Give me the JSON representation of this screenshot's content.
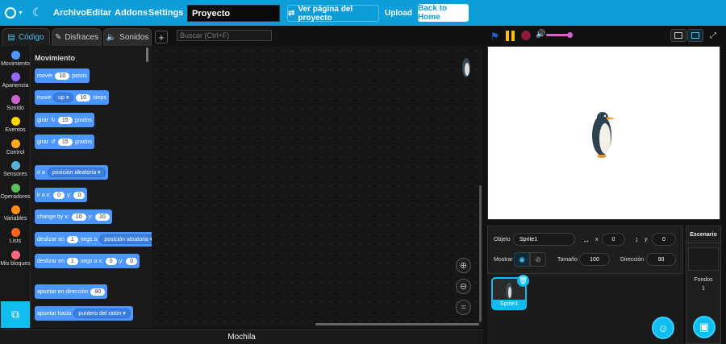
{
  "menu": {
    "items": [
      "Archivo",
      "Editar",
      "Addons",
      "Settings"
    ],
    "project_title": "Proyecto",
    "see_project": "Ver página del proyecto",
    "upload": "Upload",
    "back_home": "Back to Home"
  },
  "tabs": [
    {
      "label": "Código",
      "icon": "code-icon"
    },
    {
      "label": "Disfraces",
      "icon": "brush-icon"
    },
    {
      "label": "Sonidos",
      "icon": "speaker-icon"
    }
  ],
  "search_placeholder": "Buscar (Ctrl+F)",
  "categories": [
    {
      "label": "Movimiento",
      "color": "#4c97ff"
    },
    {
      "label": "Apariencia",
      "color": "#9966ff"
    },
    {
      "label": "Sonido",
      "color": "#cf63cf"
    },
    {
      "label": "Eventos",
      "color": "#ffd500"
    },
    {
      "label": "Control",
      "color": "#ffab19"
    },
    {
      "label": "Sensores",
      "color": "#5cb1d6"
    },
    {
      "label": "Operadores",
      "color": "#59c059"
    },
    {
      "label": "Variables",
      "color": "#ff8c1a"
    },
    {
      "label": "Lists",
      "color": "#ff661a"
    },
    {
      "label": "Mis bloques",
      "color": "#ff6680"
    }
  ],
  "palette": {
    "title": "Movimiento",
    "blocks": {
      "move_steps": {
        "a": "mover",
        "v": "10",
        "b": "pasos"
      },
      "move_dir": {
        "a": "move",
        "dd": "up",
        "v": "10",
        "b": "steps"
      },
      "turn_right": {
        "a": "girar",
        "v": "15",
        "b": "grados"
      },
      "turn_left": {
        "a": "girar",
        "v": "15",
        "b": "grados"
      },
      "goto": {
        "a": "ir a",
        "dd": "posición aleatoria"
      },
      "goto_xy": {
        "a": "ir a x:",
        "x": "0",
        "ylab": "y:",
        "y": "0"
      },
      "change_by": {
        "a": "change by x:",
        "x": "10",
        "ylab": "y:",
        "y": "10"
      },
      "glide_to": {
        "a": "deslizar en",
        "v": "1",
        "b": "segs a",
        "dd": "posición aleatoria"
      },
      "glide_xy": {
        "a": "deslizar en",
        "v": "1",
        "b": "segs a x:",
        "x": "0",
        "ylab": "y:",
        "y": "0"
      },
      "point_dir": {
        "a": "apuntar en dirección",
        "v": "90"
      },
      "point_towards": {
        "a": "apuntar hacia",
        "dd": "puntero del ratón"
      }
    }
  },
  "bottom_bar": "Mochila",
  "sprite_info": {
    "objeto_label": "Objeto",
    "objeto_value": "Sprite1",
    "x_label": "x",
    "x_value": "0",
    "y_label": "y",
    "y_value": "0",
    "mostrar_label": "Mostrar",
    "tamano_label": "Tamaño",
    "tamano_value": "100",
    "direccion_label": "Dirección",
    "direccion_value": "90"
  },
  "sprites": [
    {
      "name": "Sprite1"
    }
  ],
  "stage_pane": {
    "title": "Escenario",
    "fondos_label": "Fondos",
    "fondos_count": "1"
  }
}
